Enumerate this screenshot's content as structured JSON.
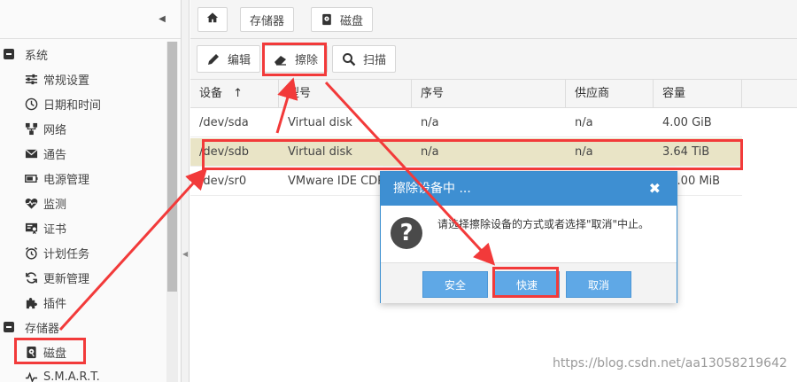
{
  "sidebar": {
    "groups": [
      {
        "label": "系统"
      },
      {
        "label": "存储器"
      }
    ],
    "system_items": [
      {
        "label": "常规设置",
        "icon": "sliders-icon"
      },
      {
        "label": "日期和时间",
        "icon": "clock-icon"
      },
      {
        "label": "网络",
        "icon": "network-icon"
      },
      {
        "label": "通告",
        "icon": "envelope-icon"
      },
      {
        "label": "电源管理",
        "icon": "battery-icon"
      },
      {
        "label": "监测",
        "icon": "heartbeat-icon"
      },
      {
        "label": "证书",
        "icon": "certificate-icon"
      },
      {
        "label": "计划任务",
        "icon": "alarm-clock-icon"
      },
      {
        "label": "更新管理",
        "icon": "refresh-icon"
      },
      {
        "label": "插件",
        "icon": "puzzle-icon"
      }
    ],
    "storage_items": [
      {
        "label": "磁盘",
        "icon": "disk-icon"
      },
      {
        "label": "S.M.A.R.T.",
        "icon": "pulse-icon"
      }
    ]
  },
  "breadcrumb": {
    "items": [
      "存储器",
      "磁盘"
    ]
  },
  "toolbar": {
    "edit_label": "编辑",
    "wipe_label": "擦除",
    "scan_label": "扫描"
  },
  "table": {
    "columns": [
      "设备",
      "型号",
      "序号",
      "供应商",
      "容量"
    ],
    "sort_indicator": "↑",
    "rows": [
      {
        "device": "/dev/sda",
        "model": "Virtual disk",
        "serial": "n/a",
        "vendor": "n/a",
        "capacity": "4.00 GiB",
        "selected": false
      },
      {
        "device": "/dev/sdb",
        "model": "Virtual disk",
        "serial": "n/a",
        "vendor": "n/a",
        "capacity": "3.64 TiB",
        "selected": true
      },
      {
        "device": "/dev/sr0",
        "model": "VMware IDE CDR0",
        "serial": "",
        "vendor": "",
        "capacity": "56.00 MiB",
        "selected": false
      }
    ]
  },
  "dialog": {
    "title": "擦除设备中 ...",
    "message": "请选择擦除设备的方式或者选择\"取消\"中止。",
    "secure_label": "安全",
    "quick_label": "快速",
    "cancel_label": "取消"
  },
  "colors": {
    "dialog_header": "#3e8fd2",
    "dialog_button": "#5fa8e6",
    "selected_row": "#e9e4c6",
    "annotation_red": "#f23a3a"
  },
  "watermark": "https://blog.csdn.net/aa13058219642"
}
